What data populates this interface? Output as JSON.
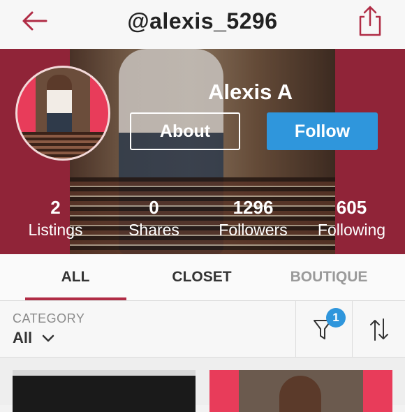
{
  "header": {
    "title": "@alexis_5296",
    "back_icon": "back-arrow-icon",
    "share_icon": "share-icon",
    "accent_color": "#b02c45"
  },
  "profile": {
    "name": "Alexis A",
    "about_label": "About",
    "follow_label": "Follow",
    "follow_color": "#2f96dc",
    "stats": [
      {
        "value": "2",
        "label": "Listings"
      },
      {
        "value": "0",
        "label": "Shares"
      },
      {
        "value": "1296",
        "label": "Followers"
      },
      {
        "value": "605",
        "label": "Following"
      }
    ]
  },
  "tabs": [
    {
      "label": "ALL",
      "active": true
    },
    {
      "label": "CLOSET",
      "active": false
    },
    {
      "label": "BOUTIQUE",
      "active": false
    }
  ],
  "filter": {
    "category_label": "CATEGORY",
    "category_value": "All",
    "filter_count": "1",
    "filter_icon": "filter-funnel-icon",
    "sort_icon": "sort-arrows-icon"
  }
}
